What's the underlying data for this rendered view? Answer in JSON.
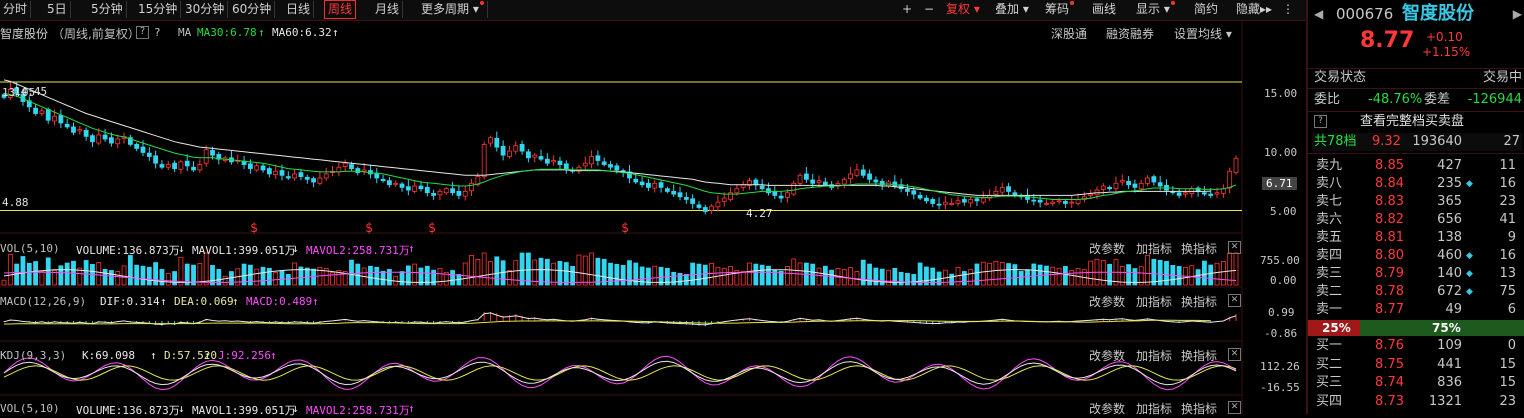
{
  "toolbar": {
    "periods": [
      "分时",
      "5日",
      "5分钟",
      "15分钟",
      "30分钟",
      "60分钟",
      "日线",
      "周线",
      "月线",
      "更多周期"
    ],
    "active_period": "周线",
    "right_buttons": [
      "+",
      "−",
      "复权",
      "叠加",
      "筹码",
      "画线",
      "显示",
      "简约",
      "隐藏"
    ]
  },
  "main_chart": {
    "stock_name": "智度股份",
    "mode": "（周线,前复权）",
    "help": "?",
    "ma_label": "MA",
    "ma30": "MA30:6.78",
    "ma60": "MA60:6.32",
    "links": [
      "深股通",
      "融资融券",
      "设置均线"
    ],
    "high_label": "14.45",
    "low_label": "4.27",
    "left_label": "4.88",
    "left_label2": "13.05",
    "price_axis": [
      "15.00",
      "10.00",
      "5.00"
    ],
    "current_price_tag": "6.71",
    "hline_values": [
      14.45,
      4.88
    ],
    "marker_glyph": "$",
    "colors": {
      "up": "#ff3333",
      "down": "#33d6f0",
      "ma30": "#22dd44",
      "ma60": "#e8e8e8",
      "price_line": "#e6e64c"
    }
  },
  "indicators": [
    {
      "name": "VOL(5,10)",
      "v1": "VOLUME:136.873万",
      "v2": "MAVOL1:399.051万",
      "v3": "MAVOL2:258.731万",
      "axis": [
        "755.00",
        "0.00"
      ]
    },
    {
      "name": "MACD(12,26,9)",
      "v1": "DIF:0.314",
      "v2": "DEA:0.069",
      "v3": "MACD:0.489",
      "axis": [
        "0.99",
        "-0.86"
      ]
    },
    {
      "name": "KDJ(9,3,3)",
      "v1": "K:69.098",
      "v2": "D:57.520",
      "v3": "J:92.256",
      "axis": [
        "112.26",
        "-16.55"
      ]
    },
    {
      "name": "VOL(5,10)",
      "v1": "VOLUME:136.873万",
      "v2": "MAVOL1:399.051万",
      "v3": "MAVOL2:258.731万",
      "axis": []
    }
  ],
  "panel_buttons": [
    "改参数",
    "加指标",
    "换指标"
  ],
  "quote": {
    "code": "000676",
    "name": "智度股份",
    "price": "8.77",
    "change": "+0.10",
    "change_pct": "+1.15%",
    "status_label": "交易状态",
    "status_value": "交易中",
    "wb_label": "委比",
    "wb_value": "-48.76%",
    "wc_label": "委差",
    "wc_value": "-126944",
    "full_book": "查看完整档买卖盘",
    "levels_label": "共78档",
    "levels_price": "9.32",
    "levels_vol": "193640",
    "levels_cnt": "27",
    "asks": [
      {
        "label": "卖九",
        "price": "8.85",
        "vol": "427",
        "cnt": "11",
        "dot": false
      },
      {
        "label": "卖八",
        "price": "8.84",
        "vol": "235",
        "cnt": "16",
        "dot": true
      },
      {
        "label": "卖七",
        "price": "8.83",
        "vol": "365",
        "cnt": "23",
        "dot": false
      },
      {
        "label": "卖六",
        "price": "8.82",
        "vol": "656",
        "cnt": "41",
        "dot": false
      },
      {
        "label": "卖五",
        "price": "8.81",
        "vol": "138",
        "cnt": "9",
        "dot": false
      },
      {
        "label": "卖四",
        "price": "8.80",
        "vol": "460",
        "cnt": "16",
        "dot": true
      },
      {
        "label": "卖三",
        "price": "8.79",
        "vol": "140",
        "cnt": "13",
        "dot": true
      },
      {
        "label": "卖二",
        "price": "8.78",
        "vol": "672",
        "cnt": "75",
        "dot": true
      },
      {
        "label": "卖一",
        "price": "8.77",
        "vol": "49",
        "cnt": "6",
        "dot": false
      }
    ],
    "ratio_left": "25%",
    "ratio_right": "75%",
    "bids": [
      {
        "label": "买一",
        "price": "8.76",
        "vol": "109",
        "cnt": "0"
      },
      {
        "label": "买二",
        "price": "8.75",
        "vol": "441",
        "cnt": "15"
      },
      {
        "label": "买三",
        "price": "8.74",
        "vol": "836",
        "cnt": "15"
      },
      {
        "label": "买四",
        "price": "8.73",
        "vol": "1321",
        "cnt": "23"
      }
    ]
  },
  "chart_data": {
    "type": "candlestick",
    "ylim": [
      3.5,
      17.5
    ],
    "close": [
      13.3,
      13.9,
      13.6,
      13.0,
      12.6,
      12.1,
      12.3,
      11.6,
      11.9,
      11.4,
      11.1,
      10.7,
      10.9,
      10.4,
      10.0,
      10.5,
      10.2,
      9.9,
      10.2,
      10.4,
      9.8,
      9.5,
      9.2,
      8.9,
      8.4,
      8.1,
      8.3,
      8.0,
      8.5,
      8.2,
      7.9,
      8.3,
      9.4,
      9.0,
      8.7,
      8.8,
      8.5,
      8.6,
      8.3,
      8.0,
      8.2,
      7.9,
      7.6,
      7.8,
      7.5,
      7.3,
      7.6,
      7.4,
      7.2,
      7.0,
      7.3,
      7.6,
      7.8,
      8.1,
      8.4,
      8.0,
      7.7,
      7.9,
      7.6,
      7.3,
      7.1,
      6.8,
      6.9,
      6.6,
      6.4,
      6.7,
      6.5,
      6.2,
      6.0,
      6.3,
      6.5,
      6.2,
      6.0,
      6.3,
      6.9,
      7.4,
      9.8,
      10.3,
      9.6,
      9.0,
      9.3,
      9.7,
      9.3,
      8.8,
      9.0,
      8.7,
      8.4,
      8.6,
      8.3,
      8.0,
      7.8,
      8.1,
      8.4,
      8.9,
      8.6,
      8.3,
      8.1,
      7.9,
      7.7,
      7.3,
      7.0,
      6.8,
      6.6,
      6.9,
      6.6,
      6.3,
      6.1,
      5.9,
      5.7,
      5.4,
      5.1,
      4.8,
      5.2,
      5.5,
      5.8,
      6.2,
      6.5,
      6.8,
      7.1,
      6.8,
      6.5,
      6.2,
      6.0,
      5.8,
      6.2,
      6.9,
      7.5,
      7.2,
      6.9,
      7.1,
      6.8,
      6.6,
      6.9,
      7.2,
      7.6,
      7.9,
      7.5,
      7.2,
      7.0,
      6.8,
      7.0,
      6.7,
      6.5,
      6.3,
      6.1,
      5.8,
      5.6,
      5.4,
      5.3,
      5.5,
      5.4,
      5.6,
      5.5,
      5.7,
      5.6,
      5.8,
      6.0,
      6.3,
      6.6,
      6.3,
      6.0,
      5.9,
      5.7,
      5.6,
      5.5,
      5.4,
      5.5,
      5.6,
      5.4,
      5.5,
      5.7,
      5.9,
      6.1,
      6.4,
      6.7,
      6.5,
      6.9,
      7.1,
      6.8,
      6.6,
      6.9,
      7.3,
      7.0,
      6.7,
      6.4,
      6.2,
      6.0,
      6.2,
      6.5,
      6.3,
      6.1,
      6.0,
      6.2,
      6.5,
      7.8,
      8.77
    ],
    "ma30": [
      13.6,
      13.5,
      13.4,
      13.2,
      13.0,
      12.8,
      12.6,
      12.4,
      12.2,
      12.0,
      11.8,
      11.6,
      11.4,
      11.2,
      11.0,
      10.85,
      10.7,
      10.55,
      10.45,
      10.35,
      10.2,
      10.05,
      9.9,
      9.75,
      9.6,
      9.45,
      9.3,
      9.15,
      9.05,
      8.95,
      8.85,
      8.8,
      8.8,
      8.8,
      8.75,
      8.7,
      8.65,
      8.6,
      8.55,
      8.5,
      8.45,
      8.4,
      8.3,
      8.2,
      8.1,
      8.0,
      7.95,
      7.9,
      7.85,
      7.8,
      7.75,
      7.75,
      7.75,
      7.75,
      7.8,
      7.8,
      7.8,
      7.75,
      7.7,
      7.65,
      7.6,
      7.5,
      7.4,
      7.3,
      7.2,
      7.1,
      7.0,
      6.95,
      6.9,
      6.85,
      6.8,
      6.75,
      6.7,
      6.7,
      6.75,
      6.85,
      7.0,
      7.2,
      7.35,
      7.5,
      7.6,
      7.7,
      7.8,
      7.85,
      7.9,
      7.95,
      7.95,
      7.95,
      7.95,
      7.95,
      7.9,
      7.9,
      7.9,
      7.9,
      7.9,
      7.85,
      7.8,
      7.75,
      7.7,
      7.65,
      7.55,
      7.45,
      7.35,
      7.25,
      7.15,
      7.05,
      6.95,
      6.85,
      6.75,
      6.6,
      6.45,
      6.3,
      6.2,
      6.15,
      6.1,
      6.1,
      6.1,
      6.15,
      6.2,
      6.25,
      6.3,
      6.3,
      6.3,
      6.3,
      6.35,
      6.4,
      6.5,
      6.55,
      6.6,
      6.65,
      6.7,
      6.7,
      6.7,
      6.75,
      6.8,
      6.85,
      6.85,
      6.85,
      6.85,
      6.85,
      6.85,
      6.8,
      6.75,
      6.7,
      6.65,
      6.55,
      6.45,
      6.35,
      6.25,
      6.15,
      6.05,
      6.0,
      5.95,
      5.9,
      5.85,
      5.85,
      5.85,
      5.9,
      5.95,
      5.95,
      5.95,
      5.95,
      5.9,
      5.85,
      5.8,
      5.75,
      5.7,
      5.7,
      5.7,
      5.7,
      5.7,
      5.75,
      5.8,
      5.9,
      6.0,
      6.05,
      6.15,
      6.25,
      6.3,
      6.35,
      6.4,
      6.5,
      6.55,
      6.55,
      6.55,
      6.55,
      6.5,
      6.5,
      6.5,
      6.5,
      6.45,
      6.45,
      6.45,
      6.5,
      6.6,
      6.78
    ],
    "ma60": [
      14.6,
      14.5,
      14.3,
      14.1,
      13.9,
      13.7,
      13.5,
      13.3,
      13.1,
      12.9,
      12.7,
      12.5,
      12.3,
      12.1,
      11.95,
      11.8,
      11.65,
      11.5,
      11.35,
      11.2,
      11.05,
      10.9,
      10.75,
      10.6,
      10.45,
      10.3,
      10.15,
      10.0,
      9.9,
      9.8,
      9.7,
      9.6,
      9.55,
      9.5,
      9.45,
      9.4,
      9.35,
      9.3,
      9.25,
      9.2,
      9.15,
      9.1,
      9.05,
      9.0,
      8.95,
      8.9,
      8.85,
      8.8,
      8.75,
      8.7,
      8.65,
      8.6,
      8.55,
      8.5,
      8.45,
      8.4,
      8.35,
      8.3,
      8.25,
      8.2,
      8.15,
      8.1,
      8.05,
      8.0,
      7.95,
      7.9,
      7.85,
      7.8,
      7.75,
      7.7,
      7.65,
      7.6,
      7.55,
      7.5,
      7.5,
      7.5,
      7.5,
      7.55,
      7.6,
      7.65,
      7.7,
      7.75,
      7.8,
      7.85,
      7.9,
      7.9,
      7.9,
      7.9,
      7.9,
      7.9,
      7.85,
      7.85,
      7.85,
      7.85,
      7.85,
      7.85,
      7.8,
      7.8,
      7.75,
      7.7,
      7.65,
      7.6,
      7.55,
      7.5,
      7.45,
      7.4,
      7.35,
      7.3,
      7.25,
      7.2,
      7.1,
      7.0,
      6.95,
      6.9,
      6.85,
      6.8,
      6.8,
      6.8,
      6.8,
      6.8,
      6.8,
      6.75,
      6.75,
      6.75,
      6.75,
      6.75,
      6.75,
      6.75,
      6.75,
      6.75,
      6.75,
      6.75,
      6.75,
      6.75,
      6.75,
      6.75,
      6.75,
      6.75,
      6.75,
      6.7,
      6.7,
      6.65,
      6.6,
      6.55,
      6.5,
      6.45,
      6.4,
      6.35,
      6.3,
      6.25,
      6.2,
      6.15,
      6.1,
      6.05,
      6.0,
      6.0,
      6.0,
      6.0,
      6.0,
      6.0,
      6.0,
      6.0,
      6.0,
      6.0,
      6.0,
      6.0,
      6.0,
      6.0,
      6.0,
      6.0,
      6.05,
      6.1,
      6.15,
      6.2,
      6.2,
      6.25,
      6.25,
      6.3,
      6.3,
      6.3,
      6.3,
      6.3,
      6.3,
      6.3,
      6.3,
      6.3,
      6.3,
      6.3,
      6.3,
      6.3,
      6.3,
      6.32
    ]
  }
}
